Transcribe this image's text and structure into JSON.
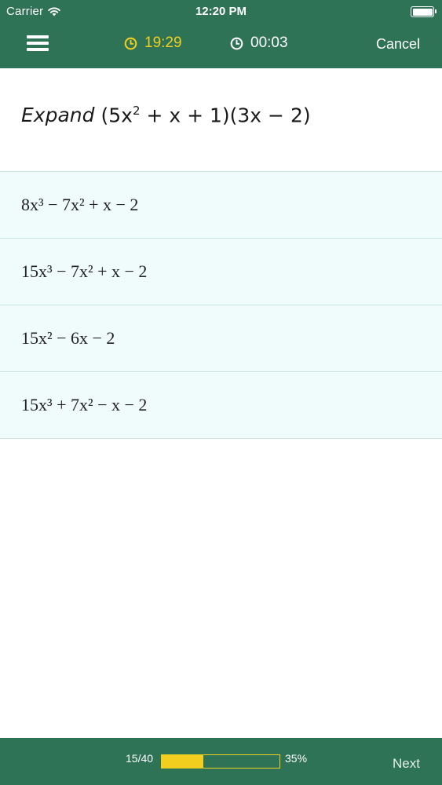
{
  "status_bar": {
    "carrier": "Carrier",
    "time": "12:20 PM",
    "icons": [
      "wifi-icon",
      "battery-icon"
    ]
  },
  "nav": {
    "menu_icon": "menu-icon",
    "remaining_time": "19:29",
    "elapsed_time": "00:03",
    "cancel_label": "Cancel",
    "timer_icon": "clock-icon"
  },
  "question": {
    "verb": "Expand",
    "expression_parts": {
      "a": "(5x",
      "a_exp": "2",
      "b": " + x + 1)(3x − 2)"
    }
  },
  "answers": [
    {
      "label": "8x³ − 7x² + x − 2"
    },
    {
      "label": "15x³ − 7x² + x − 2"
    },
    {
      "label": "15x² − 6x − 2"
    },
    {
      "label": "15x³ + 7x² − x − 2"
    }
  ],
  "footer": {
    "count": "15/40",
    "percent": "35%",
    "progress": 0.35,
    "next_label": "Next"
  },
  "colors": {
    "header_bg": "#2f7357",
    "accent_yellow": "#f2cf1f",
    "answer_bg": "#f0fbfb",
    "divider": "#c9e6df"
  }
}
